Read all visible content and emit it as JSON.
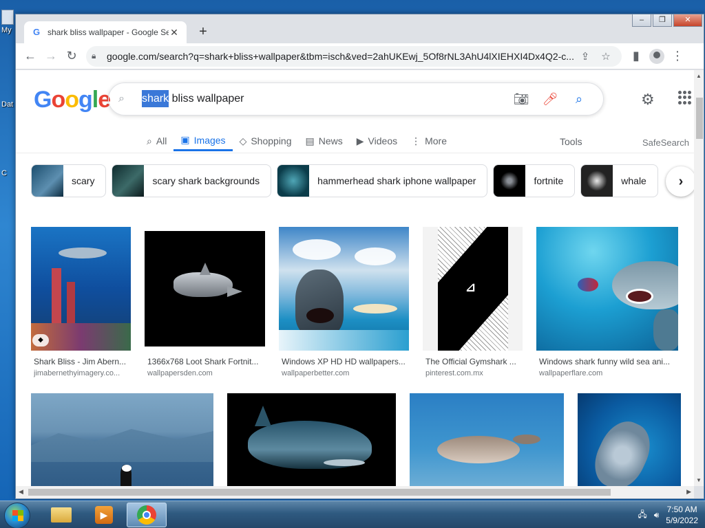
{
  "desktop": {
    "icons": [
      {
        "label": "My"
      },
      {
        "label": "Dat"
      },
      {
        "label": "C"
      }
    ]
  },
  "browser": {
    "tab_title": "shark bliss wallpaper - Google Se",
    "new_tab": "+",
    "url": "google.com/search?q=shark+bliss+wallpaper&tbm=isch&ved=2ahUKEwj_5Of8rNL3AhU4lXIEHXI4Dx4Q2-c...",
    "window_buttons": {
      "min": "–",
      "max": "❐",
      "close": "✕"
    }
  },
  "google": {
    "logo": [
      "G",
      "o",
      "o",
      "g",
      "l",
      "e"
    ],
    "query_selected": "shark",
    "query_rest": " bliss wallpaper",
    "tabs": [
      {
        "icon": "⌕",
        "label": "All"
      },
      {
        "icon": "▣",
        "label": "Images"
      },
      {
        "icon": "◇",
        "label": "Shopping"
      },
      {
        "icon": "▤",
        "label": "News"
      },
      {
        "icon": "▶",
        "label": "Videos"
      },
      {
        "icon": "⋮",
        "label": "More"
      }
    ],
    "tools": "Tools",
    "safesearch": "SafeSearch",
    "chips": [
      "scary",
      "scary shark backgrounds",
      "hammerhead shark iphone wallpaper",
      "fortnite",
      "whale"
    ],
    "results": [
      {
        "title": "Shark Bliss - Jim Abern...",
        "source": "jimabernethyimagery.co..."
      },
      {
        "title": "1366x768 Loot Shark Fortnit...",
        "source": "wallpapersden.com"
      },
      {
        "title": "Windows XP HD HD wallpapers...",
        "source": "wallpaperbetter.com"
      },
      {
        "title": "The Official Gymshark ...",
        "source": "pinterest.com.mx"
      },
      {
        "title": "Windows shark funny wild sea ani...",
        "source": "wallpaperflare.com"
      }
    ]
  },
  "taskbar": {
    "time": "7:50 AM",
    "date": "5/9/2022"
  }
}
